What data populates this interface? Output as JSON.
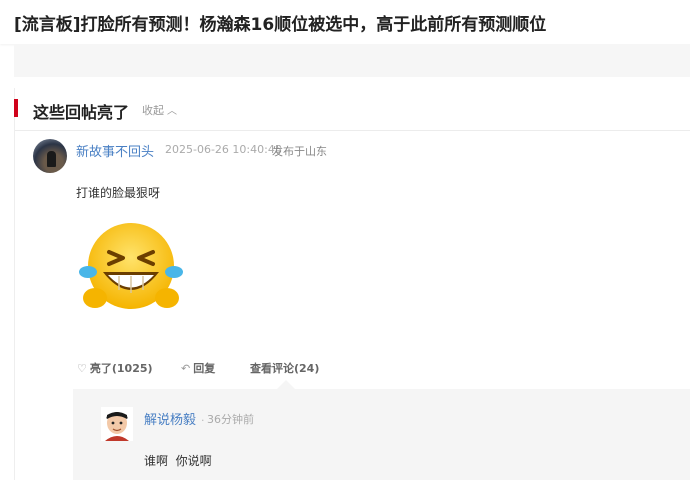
{
  "page": {
    "title": "[流言板]打脸所有预测！杨瀚森16顺位被选中，高于此前所有预测顺位"
  },
  "section": {
    "title": "这些回帖亮了",
    "collapse_label": "收起"
  },
  "post": {
    "username": "新故事不回头",
    "time": "2025-06-26 10:40:45",
    "location": "发布于山东",
    "text": "打谁的脸最狠呀",
    "emoji": "laughing-with-tears",
    "actions": {
      "like_label": "亮了(1025)",
      "reply_label": "回复",
      "comments_label": "查看评论(24)"
    }
  },
  "reply": {
    "username": "解说杨毅",
    "separator": ".",
    "time": "36分钟前",
    "text": "谁啊  你说啊"
  },
  "colors": {
    "accent_red": "#d0021b",
    "link_blue": "#4a80c4",
    "reply_bg": "#f5f5f5"
  }
}
